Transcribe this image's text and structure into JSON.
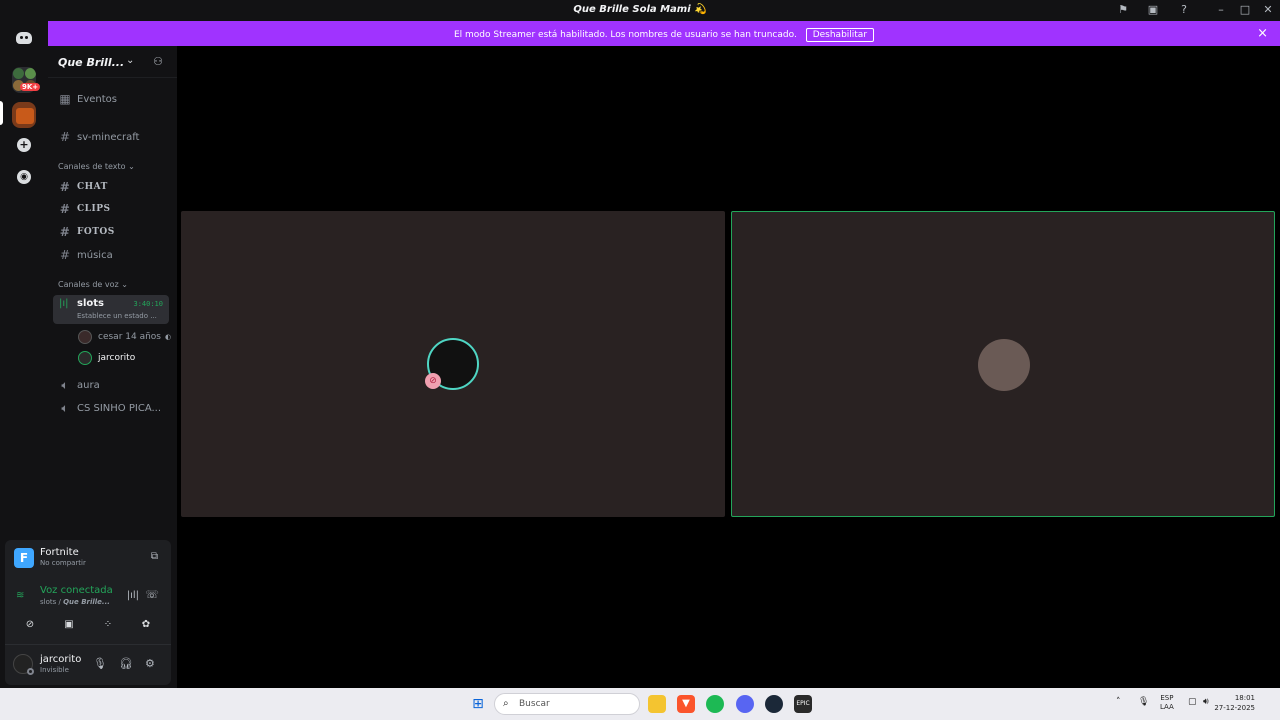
{
  "window": {
    "title": "Que Brille Sola Mami 💫"
  },
  "rail": {
    "unread_badge": "9K+"
  },
  "banner": {
    "message": "El modo Streamer está habilitado. Los nombres de usuario se han truncado.",
    "button": "Deshabilitar",
    "close_icon": "×"
  },
  "server": {
    "name": "Que Brill...",
    "events_label": "Eventos",
    "channels": [
      "sv-minecraft"
    ],
    "text_category": "Canales de texto",
    "text_channels": [
      "CHAT",
      "CLIPS",
      "FOTOS",
      "música"
    ],
    "voice_category": "Canales de voz",
    "active_voice": {
      "name": "slots",
      "timer": "3:40:10",
      "status": "Establece un estado ..."
    },
    "members": [
      {
        "name": "cesar 14 años"
      },
      {
        "name": "jarcorito"
      }
    ],
    "other_voice": [
      "aura",
      "CS SINHO PICA..."
    ]
  },
  "panel": {
    "activity_name": "Fortnite",
    "activity_sub": "No compartir",
    "activity_icon_letter": "F",
    "voice_title": "Voz conectada",
    "voice_channel": "slots / ",
    "voice_server": "Que Brille...",
    "username": "jarcorito",
    "user_status": "Invisible"
  },
  "taskbar": {
    "search_placeholder": "Buscar",
    "lang_top": "ESP",
    "lang_bottom": "LAA",
    "time": "18:01",
    "date": "27-12-2025"
  },
  "colors": {
    "banner": "#a033ff",
    "speaking": "#23a55a",
    "tile_bg": "#292222"
  }
}
